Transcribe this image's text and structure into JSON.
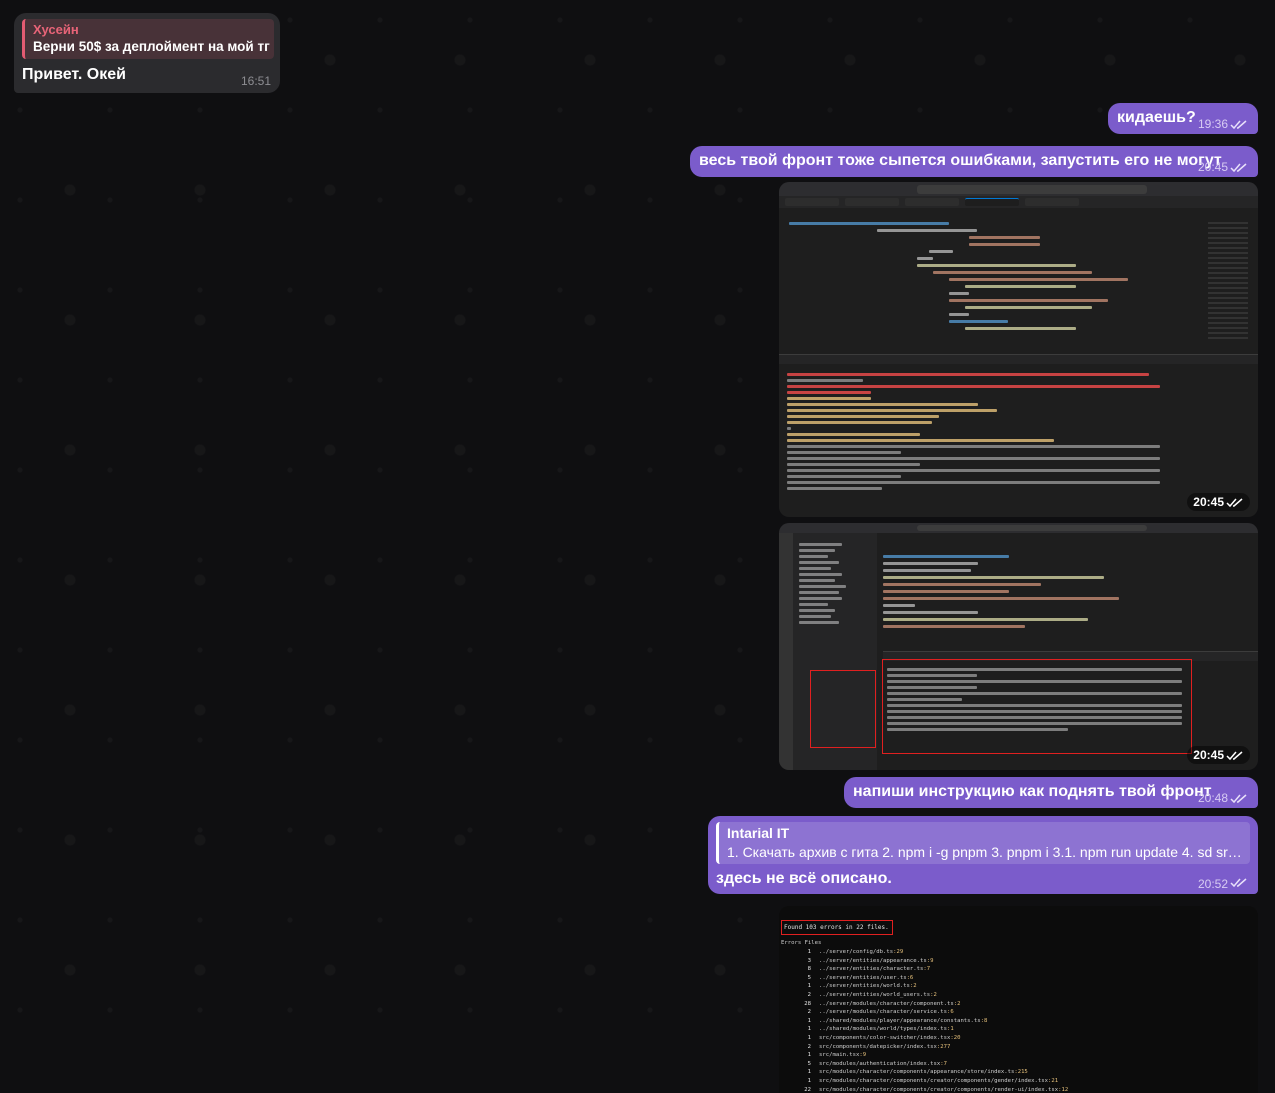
{
  "messages": {
    "incoming": {
      "reply_name": "Хусейн",
      "reply_text": "Верни 50$ за деплоймент на мой тг",
      "text": "Привет. Окей",
      "time": "16:51"
    },
    "out1": {
      "text": "кидаешь?",
      "time": "19:36"
    },
    "out2": {
      "text": "весь твой фронт тоже сыпется ошибками, запустить его не могут",
      "time": "20:45"
    },
    "shot1": {
      "time": "20:45"
    },
    "shot2": {
      "time": "20:45"
    },
    "out3": {
      "text": "напиши инструкцию как поднять твой фронт",
      "time": "20:48"
    },
    "out4": {
      "reply_name": "Intarial IT",
      "reply_text": "1. Скачать архив с гита 2. npm i -g pnpm 3. pnpm i 3.1. npm run update 4. sd src...",
      "text": "здесь не всё описано.",
      "time": "20:52"
    }
  },
  "error_shot": {
    "header": "Found 103 errors in 22 files.",
    "columns": "Errors  Files",
    "rows": [
      {
        "count": "1",
        "path": "../server/config/db.ts",
        "line": ":29"
      },
      {
        "count": "3",
        "path": "../server/entities/appearance.ts",
        "line": ":9"
      },
      {
        "count": "8",
        "path": "../server/entities/character.ts",
        "line": ":7"
      },
      {
        "count": "5",
        "path": "../server/entities/user.ts",
        "line": ":6"
      },
      {
        "count": "1",
        "path": "../server/entities/world.ts",
        "line": ":2"
      },
      {
        "count": "2",
        "path": "../server/entities/world_users.ts",
        "line": ":2"
      },
      {
        "count": "28",
        "path": "../server/modules/character/component.ts",
        "line": ":2"
      },
      {
        "count": "2",
        "path": "../server/modules/character/service.ts",
        "line": ":6"
      },
      {
        "count": "1",
        "path": "../shared/modules/player/appearance/constants.ts",
        "line": ":8"
      },
      {
        "count": "1",
        "path": "../shared/modules/world/types/index.ts",
        "line": ":1"
      },
      {
        "count": "1",
        "path": "src/components/color-switcher/index.tsx",
        "line": ":20"
      },
      {
        "count": "2",
        "path": "src/components/datepicker/index.tsx",
        "line": ":277"
      },
      {
        "count": "1",
        "path": "src/main.tsx",
        "line": ":9"
      },
      {
        "count": "5",
        "path": "src/modules/authentication/index.tsx",
        "line": ":7"
      },
      {
        "count": "1",
        "path": "src/modules/character/components/appearance/store/index.ts",
        "line": ":215"
      },
      {
        "count": "1",
        "path": "src/modules/character/components/creator/components/gender/index.tsx",
        "line": ":21"
      },
      {
        "count": "22",
        "path": "src/modules/character/components/creator/components/render-ui/index.tsx",
        "line": ":12"
      }
    ]
  },
  "colors": {
    "outgoing_bubble": "#7b5ccb",
    "incoming_bubble": "#2b2b2e",
    "reply_accent_incoming": "#e35b72",
    "background": "#0f0f11"
  }
}
